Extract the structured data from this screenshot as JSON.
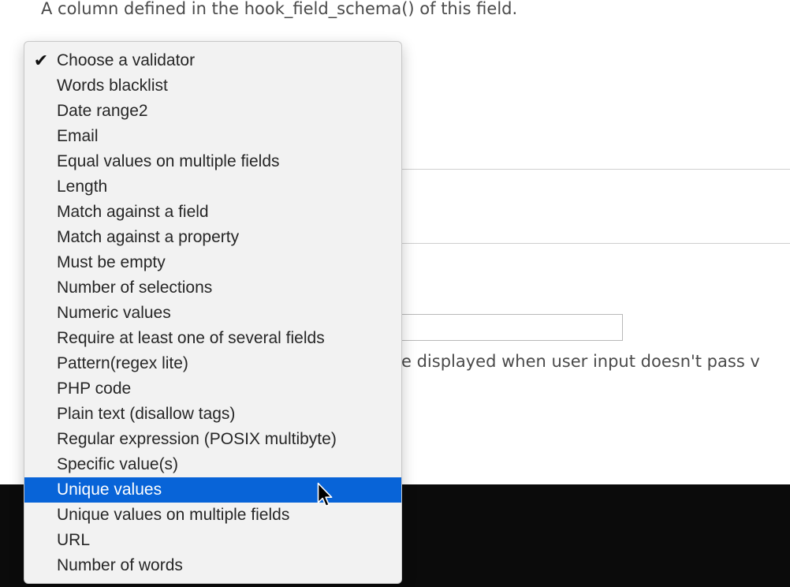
{
  "description": "A column defined in the hook_field_schema() of this field.",
  "help_text": "e displayed when user input doesn't pass v",
  "dropdown": {
    "selected_check": "✔",
    "options": [
      {
        "label": "Choose a validator",
        "checked": true
      },
      {
        "label": "Words blacklist"
      },
      {
        "label": "Date range2"
      },
      {
        "label": "Email"
      },
      {
        "label": "Equal values on multiple fields"
      },
      {
        "label": "Length"
      },
      {
        "label": "Match against a field"
      },
      {
        "label": "Match against a property"
      },
      {
        "label": "Must be empty"
      },
      {
        "label": "Number of selections"
      },
      {
        "label": "Numeric values"
      },
      {
        "label": "Require at least one of several fields"
      },
      {
        "label": "Pattern(regex lite)"
      },
      {
        "label": "PHP code"
      },
      {
        "label": "Plain text (disallow tags)"
      },
      {
        "label": "Regular expression (POSIX multibyte)"
      },
      {
        "label": "Specific value(s)"
      },
      {
        "label": "Unique values",
        "highlighted": true
      },
      {
        "label": "Unique values on multiple fields"
      },
      {
        "label": "URL"
      },
      {
        "label": "Number of words"
      }
    ]
  },
  "colors": {
    "highlight": "#0864d8",
    "menu_bg": "#f2f2f2",
    "band": "#0b0b0b"
  },
  "icons": {
    "check": "checkmark-icon",
    "cursor": "mouse-pointer-icon"
  }
}
